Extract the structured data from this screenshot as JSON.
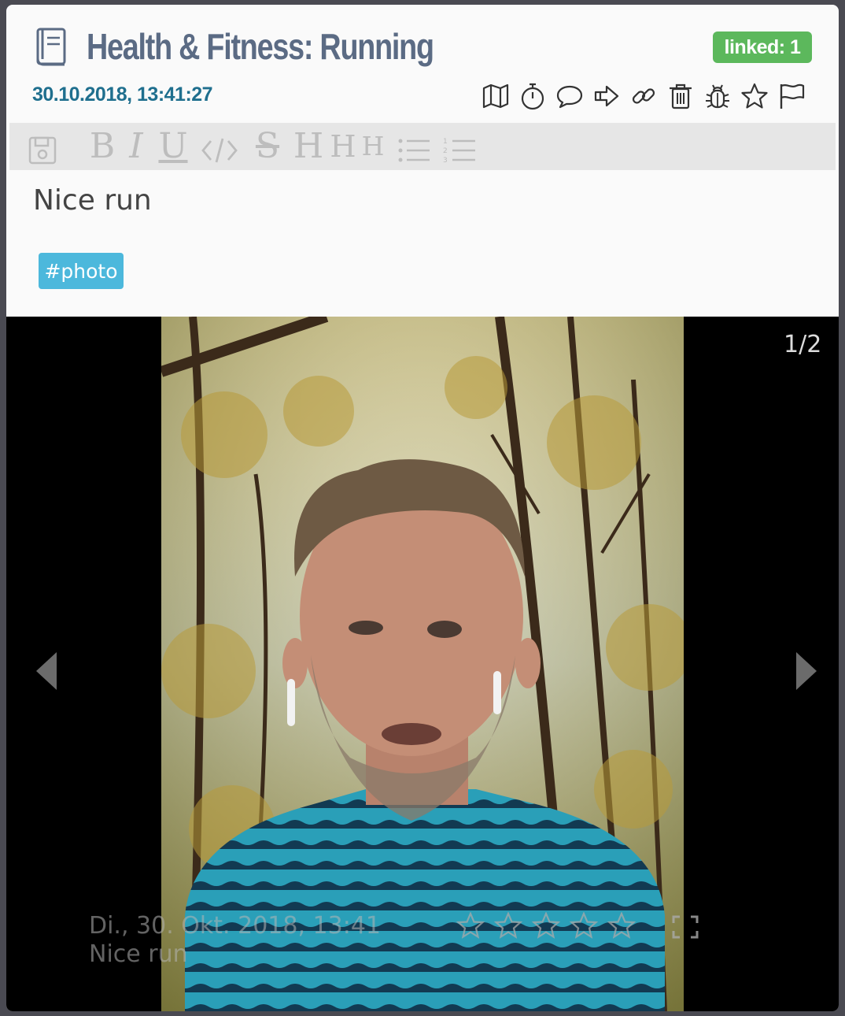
{
  "header": {
    "title": "Health & Fitness: Running",
    "linked_badge": "linked: 1",
    "timestamp": "30.10.2018, 13:41:27",
    "action_icons": [
      "map-icon",
      "stopwatch-icon",
      "comment-icon",
      "share-icon",
      "link-icon",
      "trash-icon",
      "bug-icon",
      "star-icon",
      "flag-icon"
    ]
  },
  "editor": {
    "toolbar_icons": [
      "save-icon",
      "bold-icon",
      "italic-icon",
      "underline-icon",
      "code-icon",
      "strikethrough-icon",
      "heading1-icon",
      "heading2-icon",
      "heading3-icon",
      "bullet-list-icon",
      "numbered-list-icon"
    ],
    "toolbar_labels": {
      "bold": "B",
      "italic": "I",
      "underline": "U",
      "strike": "S",
      "h1": "H",
      "h2": "H",
      "h3": "H"
    },
    "text": "Nice run",
    "hashtag": "#photo"
  },
  "gallery": {
    "counter": "1/2",
    "caption_date": "Di., 30. Okt. 2018, 13:41",
    "caption_text": "Nice run",
    "rating_stars": 5,
    "rating_value": 0
  },
  "colors": {
    "title": "#5b6b84",
    "timestamp": "#1f6f8e",
    "linked_badge": "#5cb85c",
    "hashtag": "#4cb8dc",
    "toolbar_bg": "#e6e6e6",
    "gallery_bg": "#000000"
  }
}
